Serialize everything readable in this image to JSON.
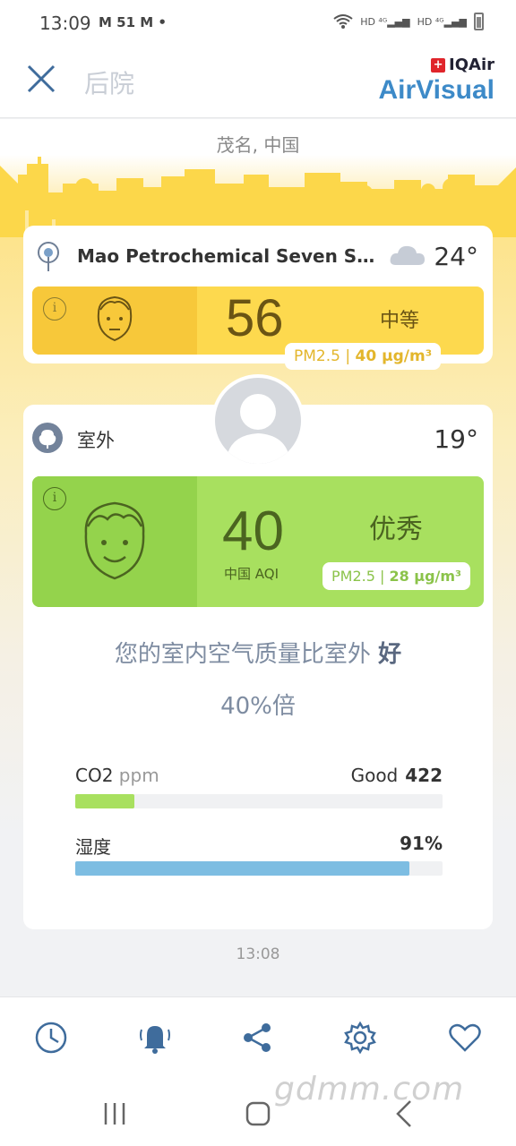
{
  "status_bar": {
    "time": "13:09",
    "notifications": "M 51 M •"
  },
  "header": {
    "title": "后院",
    "brand_top": "IQAir",
    "brand_name": "AirVisual"
  },
  "location": {
    "city": "茂名, 中国"
  },
  "station": {
    "name": "Mao Petrochemical Seven Small...",
    "temperature": "24°",
    "aqi": "56",
    "level": "中等",
    "pollutant": "PM2.5",
    "concentration": "40 µg/m³"
  },
  "outdoor": {
    "label": "室外",
    "temperature": "19°",
    "aqi": "40",
    "aqi_unit": "中国 AQI",
    "level": "优秀",
    "pollutant": "PM2.5",
    "concentration": "28 µg/m³"
  },
  "comparison": {
    "text": "您的室内空气质量比室外",
    "verdict": "好",
    "percent": "40%倍"
  },
  "metrics": {
    "co2": {
      "label": "CO2",
      "unit": "ppm",
      "status": "Good",
      "value": "422",
      "fill_fraction": 0.16,
      "color": "#a8e05f"
    },
    "humidity": {
      "label": "湿度",
      "value": "91%",
      "fill_fraction": 0.91,
      "color": "#7dbde2"
    }
  },
  "timestamp": "13:08",
  "bottom_nav": [
    "clock-icon",
    "bell-icon",
    "share-icon",
    "gear-icon",
    "heart-icon"
  ],
  "colors": {
    "moderate": "#fdd94e",
    "good": "#a8e05f",
    "brand": "#3d8ac8",
    "nav_icon": "#3f6c9c"
  },
  "watermark": "gdmm.com"
}
